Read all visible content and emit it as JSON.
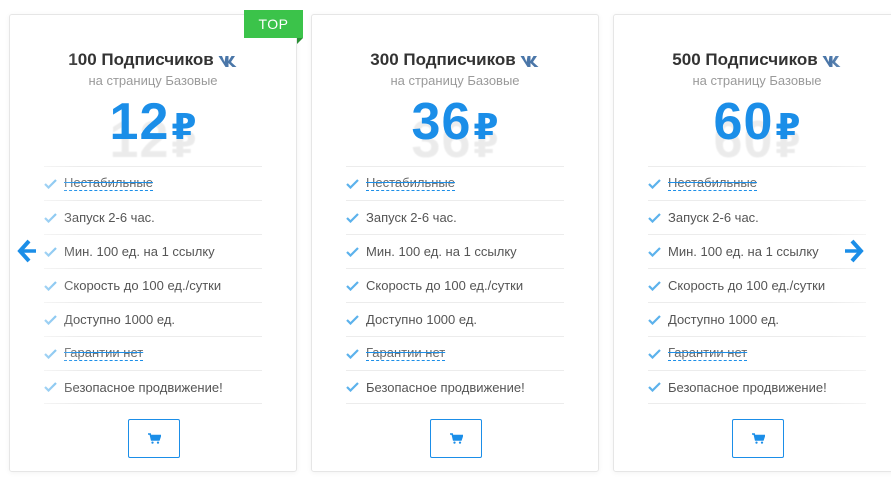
{
  "badge": "TOP",
  "plans": [
    {
      "title": "100 Подписчиков",
      "subtitle": "на страницу Базовые",
      "price": "12",
      "currency": "₽",
      "features": [
        {
          "text": "Нестабильные",
          "struck": true
        },
        {
          "text": "Запуск 2-6 час.",
          "struck": false
        },
        {
          "text": "Мин. 100 ед. на 1 ссылку",
          "struck": false
        },
        {
          "text": "Скорость до 100 ед./сутки",
          "struck": false
        },
        {
          "text": "Доступно 1000 ед.",
          "struck": false
        },
        {
          "text": "Гарантии нет",
          "struck": true
        },
        {
          "text": "Безопасное продвижение!",
          "struck": false
        }
      ]
    },
    {
      "title": "300 Подписчиков",
      "subtitle": "на страницу Базовые",
      "price": "36",
      "currency": "₽",
      "features": [
        {
          "text": "Нестабильные",
          "struck": true
        },
        {
          "text": "Запуск 2-6 час.",
          "struck": false
        },
        {
          "text": "Мин. 100 ед. на 1 ссылку",
          "struck": false
        },
        {
          "text": "Скорость до 100 ед./сутки",
          "struck": false
        },
        {
          "text": "Доступно 1000 ед.",
          "struck": false
        },
        {
          "text": "Гарантии нет",
          "struck": true
        },
        {
          "text": "Безопасное продвижение!",
          "struck": false
        }
      ]
    },
    {
      "title": "500 Подписчиков",
      "subtitle": "на страницу Базовые",
      "price": "60",
      "currency": "₽",
      "features": [
        {
          "text": "Нестабильные",
          "struck": true
        },
        {
          "text": "Запуск 2-6 час.",
          "struck": false
        },
        {
          "text": "Мин. 100 ед. на 1 ссылку",
          "struck": false
        },
        {
          "text": "Скорость до 100 ед./сутки",
          "struck": false
        },
        {
          "text": "Доступно 1000 ед.",
          "struck": false
        },
        {
          "text": "Гарантии нет",
          "struck": true
        },
        {
          "text": "Безопасное продвижение!",
          "struck": false
        }
      ]
    }
  ],
  "icons": {
    "platform": "vk-icon",
    "feature": "check-icon",
    "cart": "cart-icon",
    "prev": "arrow-left-icon",
    "next": "arrow-right-icon"
  },
  "colors": {
    "accent": "#1b8ee8",
    "badge": "#3bc34a",
    "check": "#5cb2ec"
  }
}
